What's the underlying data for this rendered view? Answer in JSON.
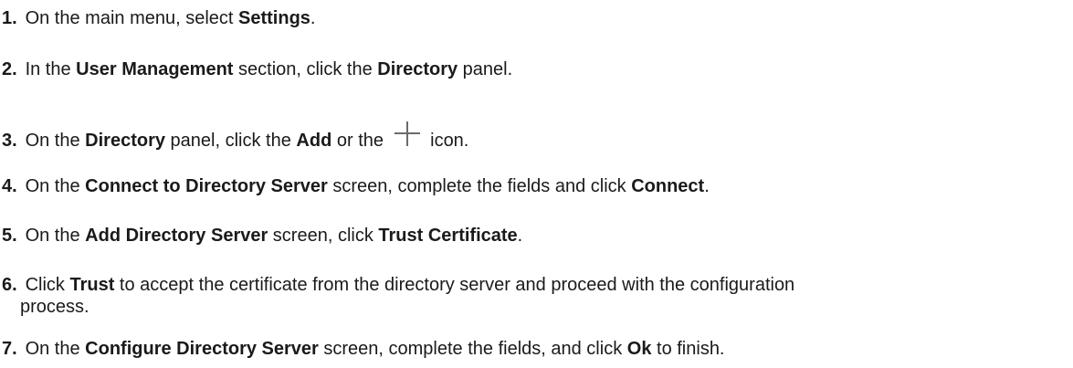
{
  "steps": [
    {
      "n": "1.",
      "a": "On the main menu, select ",
      "b": "Settings",
      "c": "."
    },
    {
      "n": "2.",
      "a": "In the ",
      "b": "User Management",
      "c": " section, click the ",
      "d": "Directory",
      "e": " panel."
    },
    {
      "n": "3.",
      "a": "On the ",
      "b": "Directory",
      "c": " panel, click the ",
      "d": "Add",
      "e": " or the ",
      "icon": "plus-icon",
      "f": " icon."
    },
    {
      "n": "4.",
      "a": "On the ",
      "b": "Connect to Directory Server",
      "c": " screen, complete the fields and click ",
      "d": "Connect",
      "e": "."
    },
    {
      "n": "5.",
      "a": "On the ",
      "b": "Add Directory Server",
      "c": " screen, click ",
      "d": "Trust Certificate",
      "e": "."
    },
    {
      "n": "6.",
      "a": "Click ",
      "b": "Trust",
      "c": " to accept the certificate from the directory server and proceed with the configuration",
      "d": "process."
    },
    {
      "n": "7.",
      "a": "On the ",
      "b": "Configure Directory Server",
      "c": " screen, complete the fields, and click ",
      "d": "Ok",
      "e": " to finish."
    }
  ]
}
